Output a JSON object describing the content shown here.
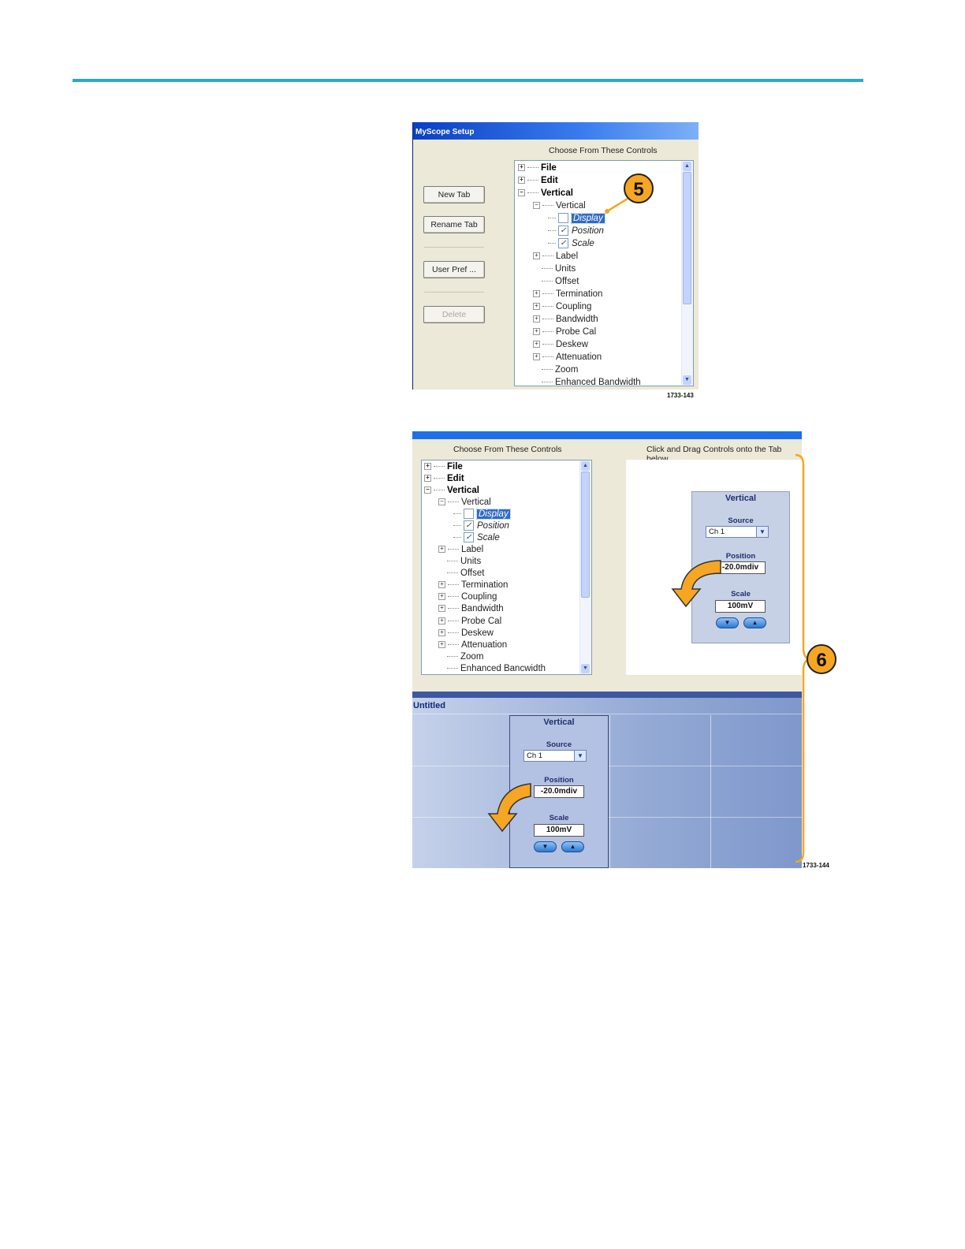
{
  "dialog": {
    "title": "MyScope Setup",
    "choose_header": "Choose From These Controls",
    "buttons": {
      "new_tab": "New Tab",
      "rename_tab": "Rename Tab",
      "user_pref": "User Pref ...",
      "delete": "Delete"
    }
  },
  "tree": {
    "file": "File",
    "edit": "Edit",
    "vertical_group": "Vertical",
    "vertical_sub": "Vertical",
    "display": "Display",
    "position": "Position",
    "scale": "Scale",
    "label": "Label",
    "units": "Units",
    "offset": "Offset",
    "termination": "Termination",
    "coupling": "Coupling",
    "bandwidth": "Bandwidth",
    "probe_cal": "Probe Cal",
    "deskew": "Deskew",
    "attenuation": "Attenuation",
    "zoom": "Zoom",
    "enhanced_bandwidth": "Enhanced Bandwidth"
  },
  "figure2": {
    "choose_header": "Choose From These Controls",
    "drag_header": "Click and Drag Controls onto the Tab below",
    "enhanced_bandwidth": "Enhanced Bancwidth",
    "tab_title": "Untitled"
  },
  "vertical_panel": {
    "title": "Vertical",
    "source_label": "Source",
    "source_value": "Ch 1",
    "position_label": "Position",
    "position_value": "-20.0mdiv",
    "scale_label": "Scale",
    "scale_value": "100mV"
  },
  "callouts": {
    "step5": "5",
    "step6": "6"
  },
  "figure_ids": {
    "fig1": "1733-143",
    "fig2": "1733-144"
  },
  "colors": {
    "accent_rule": "#2aa9c7",
    "callout": "#f6a623",
    "selection": "#316ac5",
    "title_bar": "#0a3fc4"
  }
}
